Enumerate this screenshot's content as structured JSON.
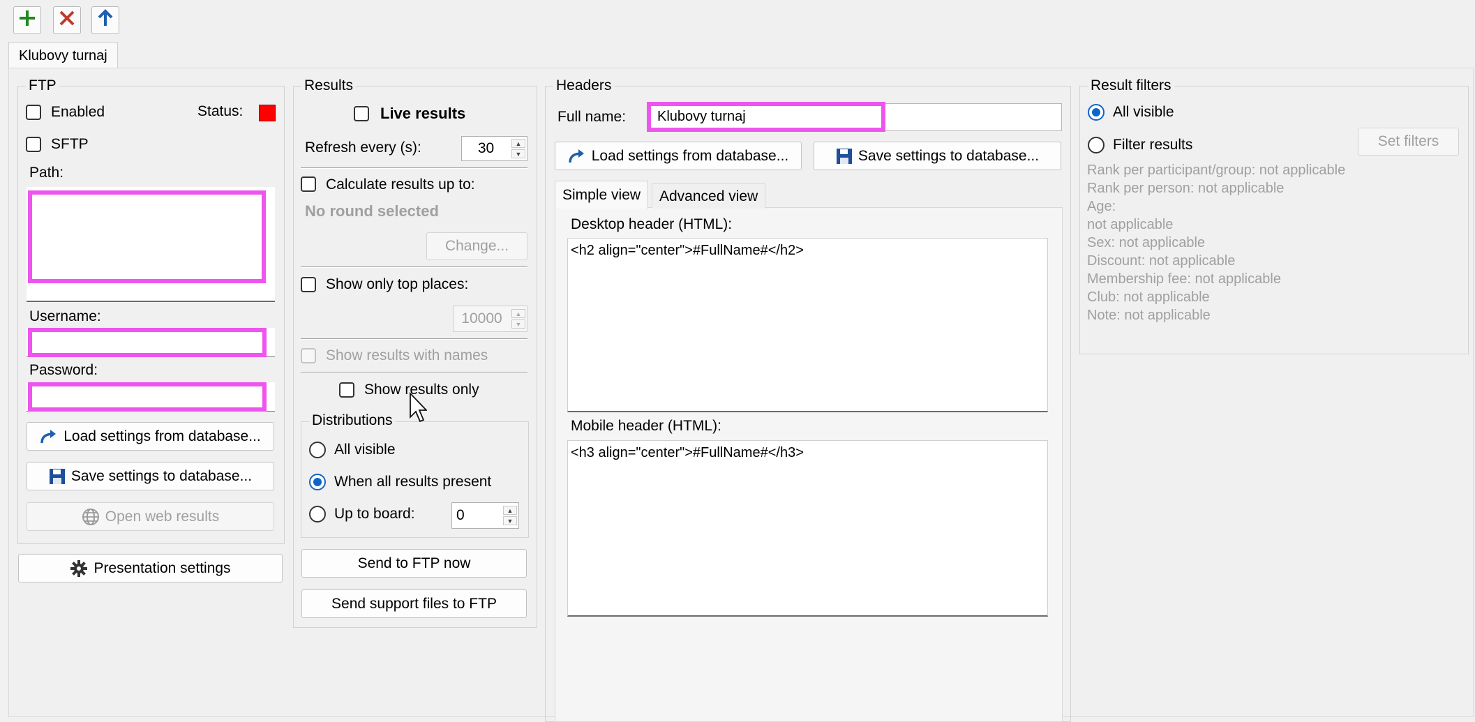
{
  "toolbar": {
    "add": "add-icon",
    "delete": "delete-icon",
    "up": "arrow-up-icon"
  },
  "tabs": [
    {
      "label": "Klubovy turnaj"
    }
  ],
  "ftp": {
    "title": "FTP",
    "enabled_label": "Enabled",
    "status_label": "Status:",
    "status_color": "#ff0000",
    "sftp_label": "SFTP",
    "path_label": "Path:",
    "path_value": "",
    "username_label": "Username:",
    "username_value": "",
    "password_label": "Password:",
    "password_value": "",
    "load_button": "Load settings from database...",
    "save_button": "Save settings to database...",
    "open_web_button": "Open web results"
  },
  "presentation_button": "Presentation settings",
  "results": {
    "title": "Results",
    "live_label": "Live results",
    "refresh_label": "Refresh every (s):",
    "refresh_value": "30",
    "calc_label": "Calculate results up to:",
    "no_round": "No round selected",
    "change_button": "Change...",
    "top_places_label": "Show only top places:",
    "top_places_value": "10000",
    "with_names_label": "Show results with names",
    "only_results_label": "Show results only",
    "distributions": {
      "title": "Distributions",
      "all_visible": "All visible",
      "when_all": "When all results present",
      "up_to_board": "Up to board:",
      "board_value": "0"
    },
    "send_ftp_button": "Send to FTP now",
    "send_support_button": "Send support files to FTP"
  },
  "headers": {
    "title": "Headers",
    "full_name_label": "Full name:",
    "full_name_value": "Klubovy turnaj",
    "load_button": "Load settings from database...",
    "save_button": "Save settings to database...",
    "tab_simple": "Simple view",
    "tab_advanced": "Advanced view",
    "desktop_label": "Desktop header (HTML):",
    "desktop_value": "<h2 align=\"center\">#FullName#</h2>",
    "mobile_label": "Mobile header (HTML):",
    "mobile_value": "<h3 align=\"center\">#FullName#</h3>"
  },
  "filters": {
    "title": "Result filters",
    "all_visible": "All visible",
    "filter_results": "Filter results",
    "set_filters_button": "Set filters",
    "lines": [
      "Rank per participant/group: not applicable",
      "Rank per person: not applicable",
      "Age:",
      "not applicable",
      "Sex: not applicable",
      "Discount: not applicable",
      "Membership fee: not applicable",
      "Club: not applicable",
      "Note: not applicable"
    ]
  }
}
